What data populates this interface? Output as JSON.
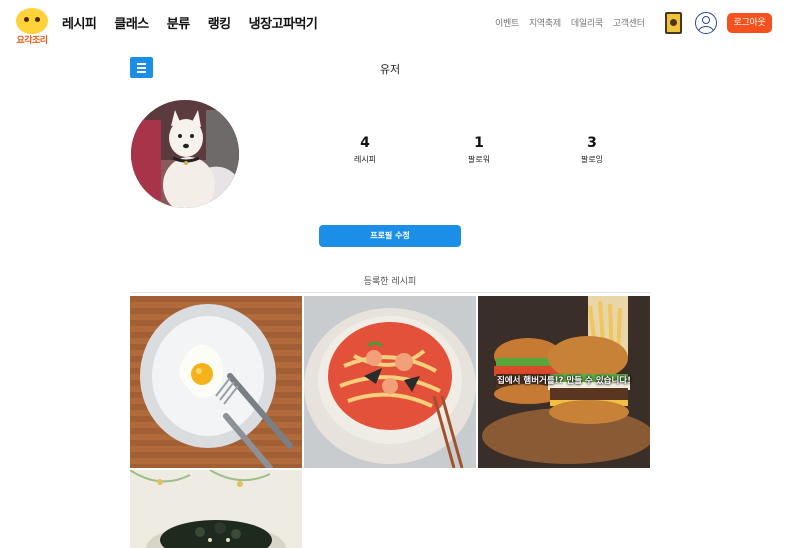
{
  "header": {
    "logo_text": "요각조리",
    "nav": [
      "레시피",
      "클래스",
      "분류",
      "랭킹",
      "냉장고파먹기"
    ],
    "util_links": [
      "이벤트",
      "지역축제",
      "데일리쿡",
      "고객센터"
    ],
    "logout_label": "로그아웃"
  },
  "profile": {
    "title": "유저",
    "stats": [
      {
        "value": "4",
        "label": "레시피"
      },
      {
        "value": "1",
        "label": "팔로워"
      },
      {
        "value": "3",
        "label": "팔로잉"
      }
    ],
    "edit_label": "프로필 수정"
  },
  "recipes": {
    "section_title": "등록한 레시피",
    "items": [
      {
        "name": "fried-egg-plate",
        "overlay": ""
      },
      {
        "name": "spicy-seafood-noodle",
        "overlay": ""
      },
      {
        "name": "hamburger",
        "overlay": "집에서 햄버거를!? 만들 수 있습니다!"
      },
      {
        "name": "seasoned-laver",
        "overlay": ""
      }
    ]
  },
  "colors": {
    "accent_blue": "#1b8ee8",
    "logout_orange": "#f4511e",
    "logo_yellow": "#ffd23a"
  }
}
